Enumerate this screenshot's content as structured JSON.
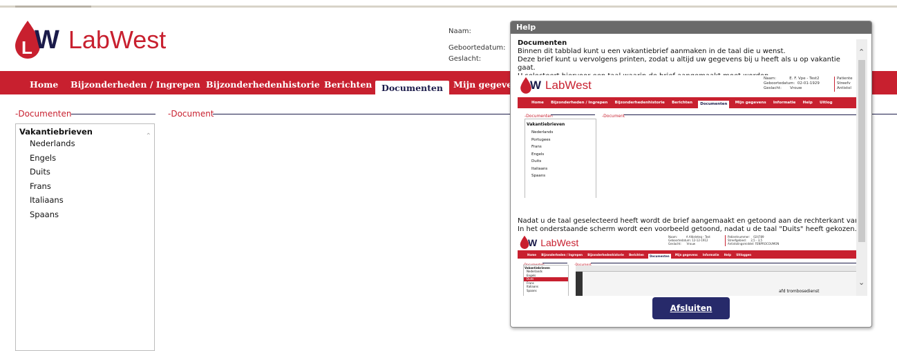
{
  "brand": {
    "mark": "W",
    "name": "LabWest",
    "red": "#c8202f",
    "navy": "#1b1b4a"
  },
  "patient_labels": [
    "Naam:",
    "Geboortedatum:",
    "Geslacht:"
  ],
  "nav": {
    "items": [
      "Home",
      "Bijzonderheden / Ingrepen",
      "Bijzonderhedenhistorie",
      "Berichten",
      "Documenten",
      "Mijn gegevens"
    ],
    "active": "Documenten"
  },
  "sections": {
    "documents": "Documenten",
    "document": "Document"
  },
  "documents_list": {
    "group": "Vakantiebrieven",
    "items": [
      "Nederlands",
      "Engels",
      "Duits",
      "Frans",
      "Italiaans",
      "Spaans"
    ]
  },
  "help": {
    "title": "Help",
    "heading": "Documenten",
    "intro": [
      "Binnen dit tabblad kunt u een vakantiebrief aanmaken in de taal die u wenst.",
      "Deze brief kunt u vervolgens printen, zodat u altijd uw gegevens bij u heeft als u op vakantie gaat.",
      "U selecteert hiervoor een taal waarin de brief aangemaakt moet worden."
    ],
    "after": [
      "Nadat u de taal geselecteerd heeft wordt de brief aangemaakt en getoond aan de rechterkant van het scherm.",
      "In het onderstaande scherm wordt een voorbeeld getoond, nadat u de taal \"Duits\" heeft gekozen."
    ],
    "close_label": "Afsluiten",
    "example1": {
      "patient": "Naam:           E. F. Vpe - Test2\nGeboortedatum:  02-01-1929\nGeslacht:       Vrouw",
      "side": "Patiente\nStreefv\nAntistol",
      "nav": [
        "Home",
        "Bijzonderheden / Ingrepen",
        "Bijzonderhedenhistorie",
        "Berichten",
        "Documenten",
        "Mijn gegevens",
        "Informatie",
        "Help",
        "Uitlog"
      ],
      "active": "Documenten",
      "group": "Vakantiebrieven",
      "langs": [
        "Nederlands",
        "Portugees",
        "Frans",
        "Engels",
        "Duits",
        "Italiaans",
        "Spaans"
      ]
    },
    "example2": {
      "patient": "Naam:          A Altieleteq - Test\nGeboortedatum: 12-12-1912\nGeslacht:      Vrouw",
      "patient2": "Patientnummer:    024789\nStreefgebied:     2,5 - 3,5\nAntistolingsmiddel: FENPROCOUMON",
      "nav": [
        "Home",
        "Bijzonderheden / Ingrepen",
        "Bijzonderhedenhistorie",
        "Berichten",
        "Documenten",
        "Mijn gegevens",
        "Informatie",
        "Help",
        "Uitloggen"
      ],
      "active": "Documenten",
      "group": "Vakantiebrieven",
      "langs": [
        "Nederlands",
        "Engels",
        "Duits",
        "Frans",
        "Italiaans",
        "Spaans"
      ],
      "selected": "Duits",
      "doc_text": "afd trombosedienst"
    }
  }
}
